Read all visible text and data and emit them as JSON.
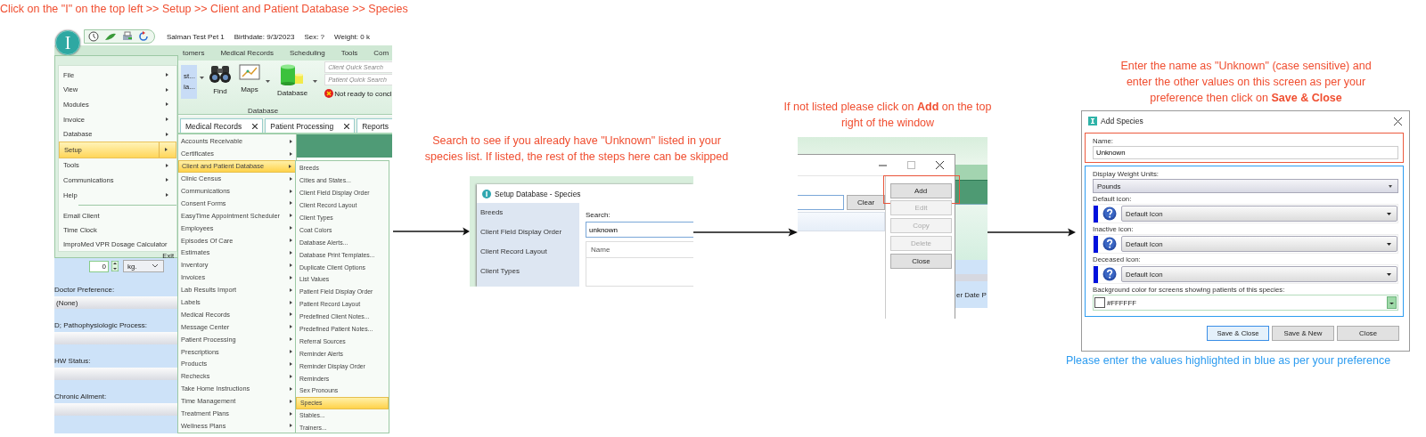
{
  "steps": [
    {
      "caption": "Click on the  \"I\" on the top left >> Setup >> Client and Patient Database >> Species",
      "screen": {
        "kind": "app_menu",
        "app_button": "I",
        "patient_bar": [
          "Salman Test Pet 1",
          "Birthdate: 9/3/2023",
          "Sex: ?",
          "Weight: 0 k"
        ],
        "ribbon_tabs": [
          "tomers",
          "Medical Records",
          "Scheduling",
          "Tools",
          "Com"
        ],
        "ribbon_cut": [
          "st...",
          "ia..."
        ],
        "ribbon_buttons": [
          {
            "label": "Find",
            "kind": "binoculars"
          },
          {
            "label": "Maps",
            "kind": "map"
          },
          {
            "label": "Database",
            "kind": "database"
          }
        ],
        "ribbon_group": "Database",
        "quick_search": [
          {
            "placeholder": "Client Quick Search"
          },
          {
            "placeholder": "Patient Quick Search"
          }
        ],
        "status": "Not ready to concl",
        "doc_tabs": [
          {
            "label": "Medical Records",
            "closable": true
          },
          {
            "label": "Patient Processing",
            "closable": true
          },
          {
            "label": "Reports",
            "closable": false
          }
        ],
        "form": {
          "weight": "0",
          "unit": "kg.",
          "fields": [
            {
              "label": "Doctor Preference:",
              "value": "(None)"
            },
            {
              "label": "D; Pathophysiologic Process:"
            },
            {
              "label": "HW Status:"
            },
            {
              "label": "Chronic Ailment:"
            }
          ]
        },
        "menu": {
          "items": [
            {
              "label": "File",
              "selected": false
            },
            {
              "label": "View",
              "selected": false
            },
            {
              "label": "Modules",
              "selected": false
            },
            {
              "label": "Invoice",
              "selected": false
            },
            {
              "label": "Database",
              "selected": false
            },
            {
              "label": "Setup",
              "selected": true
            },
            {
              "label": "Tools",
              "selected": false
            },
            {
              "label": "Communications",
              "selected": false
            },
            {
              "label": "Help",
              "selected": false
            }
          ],
          "commands": [
            "Email Client",
            "Time Clock",
            "ImproMed VPR Dosage Calculator"
          ],
          "exit": "Exit"
        },
        "submenu": [
          {
            "label": "Accounts Receivable",
            "selected": false
          },
          {
            "label": "Certificates",
            "selected": false
          },
          {
            "label": "Client and Patient Database",
            "selected": true
          },
          {
            "label": "Clinic Census",
            "selected": false
          },
          {
            "label": "Communications",
            "selected": false
          },
          {
            "label": "Consent Forms",
            "selected": false
          },
          {
            "label": "EasyTime Appointment Scheduler",
            "selected": false
          },
          {
            "label": "Employees",
            "selected": false
          },
          {
            "label": "Episodes Of Care",
            "selected": false
          },
          {
            "label": "Estimates",
            "selected": false
          },
          {
            "label": "Inventory",
            "selected": false
          },
          {
            "label": "Invoices",
            "selected": false
          },
          {
            "label": "Lab Results Import",
            "selected": false
          },
          {
            "label": "Labels",
            "selected": false
          },
          {
            "label": "Medical Records",
            "selected": false
          },
          {
            "label": "Message Center",
            "selected": false
          },
          {
            "label": "Patient Processing",
            "selected": false
          },
          {
            "label": "Prescriptions",
            "selected": false
          },
          {
            "label": "Products",
            "selected": false
          },
          {
            "label": "Rechecks",
            "selected": false
          },
          {
            "label": "Take Home Instructions",
            "selected": false
          },
          {
            "label": "Time Management",
            "selected": false
          },
          {
            "label": "Treatment Plans",
            "selected": false
          },
          {
            "label": "Wellness Plans",
            "selected": false
          }
        ],
        "subsubmenu": [
          {
            "label": "Breeds",
            "selected": false
          },
          {
            "label": "Cities and States...",
            "selected": false
          },
          {
            "label": "Client Field Display Order",
            "selected": false
          },
          {
            "label": "Client Record Layout",
            "selected": false
          },
          {
            "label": "Client Types",
            "selected": false
          },
          {
            "label": "Coat Colors",
            "selected": false
          },
          {
            "label": "Database Alerts...",
            "selected": false
          },
          {
            "label": "Database Print Templates...",
            "selected": false
          },
          {
            "label": "Duplicate Client Options",
            "selected": false
          },
          {
            "label": "List Values",
            "selected": false
          },
          {
            "label": "Patient Field Display Order",
            "selected": false
          },
          {
            "label": "Patient Record Layout",
            "selected": false
          },
          {
            "label": "Predefined Client Notes...",
            "selected": false
          },
          {
            "label": "Predefined Patient Notes...",
            "selected": false
          },
          {
            "label": "Referral Sources",
            "selected": false
          },
          {
            "label": "Reminder Alerts",
            "selected": false
          },
          {
            "label": "Reminder Display Order",
            "selected": false
          },
          {
            "label": "Reminders",
            "selected": false
          },
          {
            "label": "Sex Pronouns",
            "selected": false
          },
          {
            "label": "Species",
            "selected": true
          },
          {
            "label": "Stables...",
            "selected": false
          },
          {
            "label": "Trainers...",
            "selected": false
          }
        ]
      }
    },
    {
      "caption": "Search to see if you already have \"Unknown\" listed in your species list. If listed, the rest of the steps here can be skipped",
      "screen": {
        "kind": "species_search",
        "title": "Setup Database - Species",
        "nav": [
          "Breeds",
          "Client Field Display Order",
          "Client Record Layout",
          "Client Types"
        ],
        "search_label": "Search:",
        "search_value": "unknown",
        "columns": [
          "Name"
        ]
      }
    },
    {
      "caption": "If not listed please click on **Add** on the top right of the window",
      "screen": {
        "kind": "species_actions",
        "clear": "Clear",
        "behind_text": "er Date P",
        "buttons": [
          {
            "label": "Add",
            "disabled": false,
            "highlighted": true
          },
          {
            "label": "Edit",
            "disabled": true,
            "highlighted": false
          },
          {
            "label": "Copy",
            "disabled": true,
            "highlighted": false
          },
          {
            "label": "Delete",
            "disabled": true,
            "highlighted": false
          },
          {
            "label": "Close",
            "disabled": false,
            "highlighted": false
          }
        ]
      }
    },
    {
      "caption": "Enter the name as \"Unknown\" (case sensitive) and enter the other values on this screen as per your preference then click on **Save & Close**",
      "screen": {
        "kind": "add_species",
        "title": "Add Species",
        "groups": [
          {
            "color": "#ec5a3e",
            "fields": [
              {
                "kind": "text",
                "label": "Name:",
                "value": "Unknown"
              }
            ]
          },
          {
            "color": "#2d9cf0",
            "fields": [
              {
                "kind": "select",
                "label": "Display Weight Units:",
                "value": "Pounds"
              },
              {
                "kind": "icon_select",
                "label": "Default icon:",
                "value": "Default Icon"
              },
              {
                "kind": "icon_select",
                "label": "Inactive icon:",
                "value": "Default Icon"
              },
              {
                "kind": "icon_select",
                "label": "Deceased icon:",
                "value": "Default Icon"
              },
              {
                "kind": "color",
                "label": "Background color for screens showing patients of this species:",
                "value": "#FFFFFF"
              }
            ]
          }
        ],
        "buttons": [
          {
            "label": "Save & Close",
            "focused": true
          },
          {
            "label": "Save & New",
            "focused": false
          },
          {
            "label": "Close",
            "focused": false
          }
        ]
      }
    }
  ],
  "note": "Please enter the values highlighted in blue as per your preference"
}
